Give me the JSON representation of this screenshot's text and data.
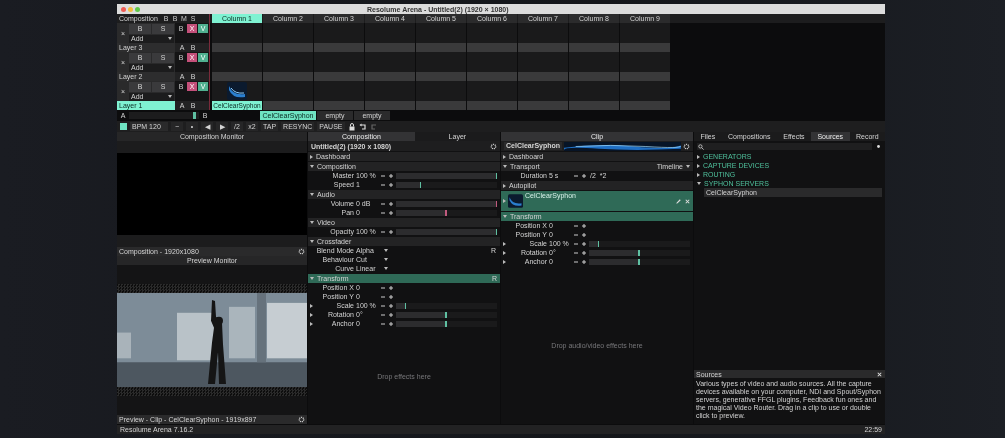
{
  "window": {
    "title": "Resolume Arena - Untitled(2) (1920 × 1080)"
  },
  "composition_header": {
    "label": "Composition",
    "buttons": [
      "B",
      "B",
      "M",
      "S"
    ]
  },
  "columns": [
    {
      "label": "Column 1",
      "selected": true
    },
    {
      "label": "Column 2",
      "selected": false
    },
    {
      "label": "Column 3",
      "selected": false
    },
    {
      "label": "Column 4",
      "selected": false
    },
    {
      "label": "Column 5",
      "selected": false
    },
    {
      "label": "Column 6",
      "selected": false
    },
    {
      "label": "Column 7",
      "selected": false
    },
    {
      "label": "Column 8",
      "selected": false
    },
    {
      "label": "Column 9",
      "selected": false
    }
  ],
  "layers": [
    {
      "name": "Layer 3",
      "selected": false,
      "buttons": [
        "×",
        "B",
        "S"
      ],
      "add": "Add",
      "toggles": [
        {
          "label": "B",
          "kind": "plain"
        },
        {
          "label": "X",
          "kind": "pink"
        },
        {
          "label": "V",
          "kind": "teal"
        }
      ],
      "ab": [
        "A",
        "B"
      ],
      "clips": [
        {
          "kind": "empty"
        },
        {
          "kind": "empty"
        },
        {
          "kind": "empty"
        },
        {
          "kind": "empty"
        },
        {
          "kind": "empty"
        },
        {
          "kind": "empty"
        },
        {
          "kind": "empty"
        },
        {
          "kind": "empty"
        },
        {
          "kind": "empty"
        }
      ]
    },
    {
      "name": "Layer 2",
      "selected": false,
      "buttons": [
        "×",
        "B",
        "S"
      ],
      "add": "Add",
      "toggles": [
        {
          "label": "B",
          "kind": "plain"
        },
        {
          "label": "X",
          "kind": "pink"
        },
        {
          "label": "V",
          "kind": "teal"
        }
      ],
      "ab": [
        "A",
        "B"
      ],
      "clips": [
        {
          "kind": "empty"
        },
        {
          "kind": "empty"
        },
        {
          "kind": "empty"
        },
        {
          "kind": "empty"
        },
        {
          "kind": "empty"
        },
        {
          "kind": "empty"
        },
        {
          "kind": "empty"
        },
        {
          "kind": "empty"
        },
        {
          "kind": "empty"
        }
      ]
    },
    {
      "name": "Layer 1",
      "selected": true,
      "buttons": [
        "×",
        "B",
        "S"
      ],
      "add": "Add",
      "toggles": [
        {
          "label": "B",
          "kind": "plain"
        },
        {
          "label": "X",
          "kind": "pink"
        },
        {
          "label": "V",
          "kind": "teal"
        }
      ],
      "ab": [
        "A",
        "B"
      ],
      "clips": [
        {
          "kind": "clip",
          "label": "CelClearSyphon"
        },
        {
          "kind": "empty"
        },
        {
          "kind": "empty"
        },
        {
          "kind": "empty"
        },
        {
          "kind": "empty"
        },
        {
          "kind": "empty"
        },
        {
          "kind": "empty"
        },
        {
          "kind": "empty"
        },
        {
          "kind": "empty"
        }
      ]
    }
  ],
  "deck": {
    "label": "A",
    "level": 0.95,
    "side_label": "B",
    "tabs": [
      {
        "label": "CelClearSyphon",
        "selected": true
      },
      {
        "label": "empty",
        "selected": false
      },
      {
        "label": "empty",
        "selected": false
      }
    ]
  },
  "toolbar": {
    "bpm": "BPM  120",
    "buttons": [
      "−",
      "•",
      "◀",
      "▶",
      "/2",
      "x2",
      "TAP",
      "RESYNC",
      "PAUSE"
    ]
  },
  "composition_monitor": {
    "title": "Composition Monitor",
    "footer": "Composition - 1920x1080"
  },
  "preview_monitor": {
    "title": "Preview Monitor",
    "footer": "Preview - Clip - CelClearSyphon - 1919x897"
  },
  "composition_panel": {
    "tabs": [
      {
        "label": "Composition",
        "selected": true
      },
      {
        "label": "Layer",
        "selected": false
      }
    ],
    "title": "Untitled(2) (1920 x 1080)",
    "empty_hint": "Drop effects here",
    "sections": [
      {
        "name": "Dashboard",
        "expanded": false,
        "highlighted": false
      },
      {
        "name": "Composition",
        "expanded": true,
        "highlighted": false,
        "params": [
          {
            "label": "Master",
            "value": "100 %",
            "kind": "slider",
            "expandable": false,
            "level": 1,
            "color": "#5fc0a2"
          },
          {
            "label": "Speed",
            "value": "1",
            "kind": "slider",
            "expandable": false,
            "level": 0.25,
            "color": "#5fc0a2"
          }
        ]
      },
      {
        "name": "Audio",
        "expanded": true,
        "highlighted": false,
        "params": [
          {
            "label": "Volume",
            "value": "0 dB",
            "kind": "slider",
            "expandable": false,
            "level": 1,
            "color": "#c05a7e"
          },
          {
            "label": "Pan",
            "value": "0",
            "kind": "slider",
            "expandable": false,
            "level": 0.5,
            "color": "#c05a7e"
          }
        ]
      },
      {
        "name": "Video",
        "expanded": true,
        "highlighted": false,
        "params": [
          {
            "label": "Opacity",
            "value": "100 %",
            "kind": "slider",
            "expandable": false,
            "level": 1,
            "color": "#5fc0a2"
          }
        ]
      },
      {
        "name": "Crossfader",
        "expanded": true,
        "highlighted": false,
        "params": [
          {
            "label": "Blend Mode",
            "value": "Alpha",
            "kind": "dropdown",
            "expandable": false,
            "end_label": "R"
          },
          {
            "label": "Behaviour",
            "value": "Cut",
            "kind": "dropdown",
            "expandable": false
          },
          {
            "label": "Curve",
            "value": "Linear",
            "kind": "dropdown",
            "expandable": false
          }
        ]
      },
      {
        "name": "Transform",
        "expanded": true,
        "highlighted": true,
        "end_label": "R",
        "params": [
          {
            "label": "Position X",
            "value": "0",
            "kind": "number",
            "expandable": false
          },
          {
            "label": "Position Y",
            "value": "0",
            "kind": "number",
            "expandable": false
          },
          {
            "label": "Scale",
            "value": "100 %",
            "kind": "slider",
            "expandable": true,
            "level": 0.1,
            "color": "#5fc0a2"
          },
          {
            "label": "Rotation",
            "value": "0°",
            "kind": "slider",
            "expandable": true,
            "level": 0.5,
            "color": "#5fc0a2"
          },
          {
            "label": "Anchor",
            "value": "0",
            "kind": "slider",
            "expandable": true,
            "level": 0.5,
            "color": "#5fc0a2"
          }
        ]
      }
    ]
  },
  "clip_panel": {
    "title": "Clip",
    "clip_name": "CelClearSyphon",
    "empty_hint": "Drop audio/video effects here",
    "sections": [
      {
        "kind": "section",
        "name": "Dashboard",
        "expanded": false,
        "highlighted": false
      },
      {
        "kind": "section",
        "name": "Transport",
        "expanded": true,
        "highlighted": false,
        "end_label": "Timeline",
        "params": [
          {
            "label": "Duration",
            "value": "5 s",
            "kind": "number",
            "expandable": false,
            "extras": [
              "/2",
              "*2"
            ]
          }
        ]
      },
      {
        "kind": "section",
        "name": "Autopilot",
        "expanded": false,
        "highlighted": false
      },
      {
        "kind": "source",
        "label": "CelClearSyphon"
      },
      {
        "kind": "section",
        "name": "Transform",
        "expanded": true,
        "highlighted": true,
        "params": [
          {
            "label": "Position X",
            "value": "0",
            "kind": "number",
            "expandable": false
          },
          {
            "label": "Position Y",
            "value": "0",
            "kind": "number",
            "expandable": false
          },
          {
            "label": "Scale",
            "value": "100 %",
            "kind": "slider",
            "expandable": true,
            "level": 0.1,
            "color": "#5fc0a2"
          },
          {
            "label": "Rotation",
            "value": "0°",
            "kind": "slider",
            "expandable": true,
            "level": 0.5,
            "color": "#5fc0a2"
          },
          {
            "label": "Anchor",
            "value": "0",
            "kind": "slider",
            "expandable": true,
            "level": 0.5,
            "color": "#5fc0a2"
          }
        ]
      }
    ]
  },
  "browser": {
    "tabs": [
      {
        "label": "Files",
        "selected": false
      },
      {
        "label": "Compositions",
        "selected": false
      },
      {
        "label": "Effects",
        "selected": false
      },
      {
        "label": "Sources",
        "selected": true
      },
      {
        "label": "Record",
        "selected": false
      }
    ],
    "tree": [
      {
        "label": "GENERATORS",
        "expanded": false
      },
      {
        "label": "CAPTURE DEVICES",
        "expanded": false
      },
      {
        "label": "ROUTING",
        "expanded": false
      },
      {
        "label": "SYPHON SERVERS",
        "expanded": true,
        "children": [
          {
            "label": "CelClearSyphon",
            "selected": true
          }
        ]
      }
    ],
    "help": {
      "title": "Sources",
      "text": "Various types of video and audio sources. All the capture devices available on your computer, NDI and Spout/Syphon servers, generative FFGL plugins, Feedback fun ones and the magical Video Router. Drag in a clip to use or double click to preview."
    }
  },
  "status_bar": {
    "left": "Resolume Arena 7.16.2",
    "right": "22:59"
  }
}
